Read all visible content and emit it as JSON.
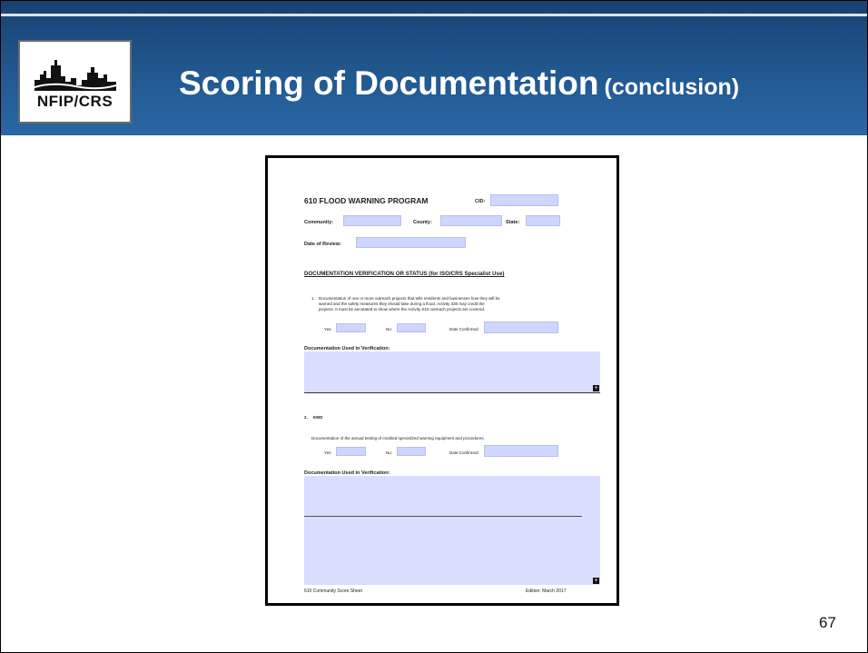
{
  "header": {
    "logo_text": "NFIP/CRS",
    "title": "Scoring of Documentation",
    "title_suffix": "(conclusion)"
  },
  "page_number": "67",
  "document": {
    "form_title": "610 FLOOD WARNING PROGRAM",
    "cid_label": "CID:",
    "community_label": "Community:",
    "county_label": "County:",
    "state_label": "State:",
    "review_label": "Date of Review:",
    "section_heading": "DOCUMENTATION VERIFICATION OR STATUS (for ISO/CRS Specialist Use)",
    "item1_number": "1.",
    "item1_line1": "Documentation of one or more outreach projects that tells residents and businesses how they will be",
    "item1_line2": "warned and the safety measures they should take during a flood.  Activity 330 may credit the",
    "item1_line3": "projects.  It must be annotated to show where the Activity 610 outreach projects are covered.",
    "yes_label": "Yes:",
    "no_label": "No:",
    "date_confirmed_label": "Date Confirmed:",
    "doc_used_label": "Documentation Used in Verification:",
    "item2_number": "2.",
    "item2_title": "EWD",
    "item2_text": "Documentation of the annual testing of credited specialized warning equipment and procedures.",
    "footer_left": "610 Community Score Sheet",
    "footer_right": "Edition:  March 2017",
    "expand_symbol": "+"
  }
}
